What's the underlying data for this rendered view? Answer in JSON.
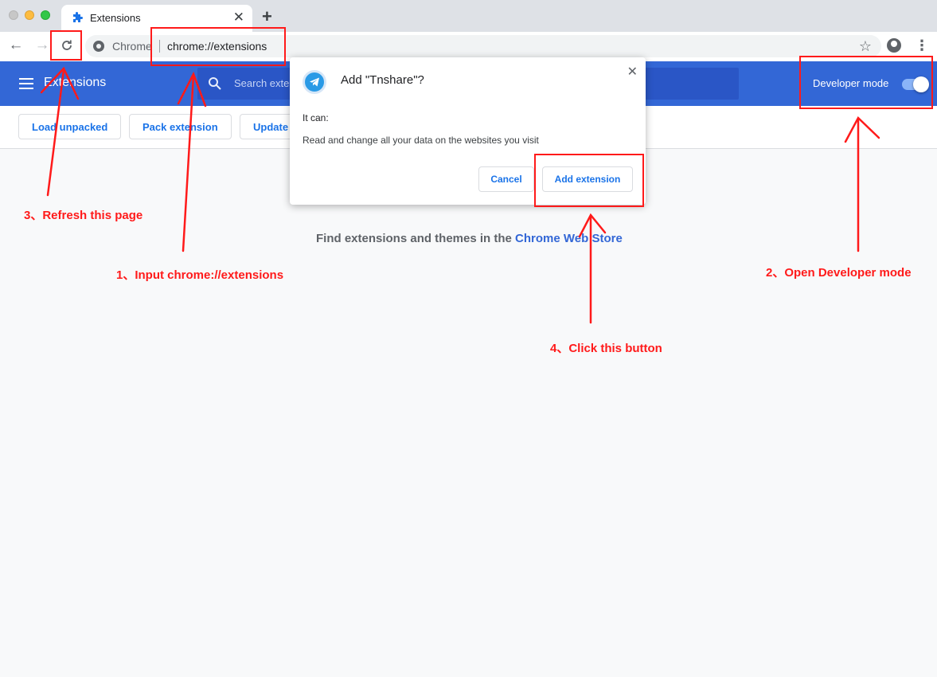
{
  "tab": {
    "title": "Extensions",
    "close": "✕"
  },
  "toolbar": {
    "site_chip": "Chrome",
    "url": "chrome://extensions"
  },
  "header": {
    "title": "Extensions",
    "search_placeholder": "Search extensions",
    "developer_mode_label": "Developer mode",
    "developer_mode_on": true
  },
  "subbar": {
    "load_unpacked": "Load unpacked",
    "pack_extension": "Pack extension",
    "update": "Update"
  },
  "main": {
    "find_text": "Find extensions and themes in the ",
    "store_link": "Chrome Web Store"
  },
  "dialog": {
    "title": "Add \"Tnshare\"?",
    "close": "✕",
    "it_can": "It can:",
    "permission": "Read and change all your data on the websites you visit",
    "cancel": "Cancel",
    "add": "Add extension"
  },
  "annotations": {
    "step1": "1、Input chrome://extensions",
    "step2": "2、Open Developer mode",
    "step3": "3、Refresh this page",
    "step4": "4、Click this button",
    "color": "#ff1a1a"
  },
  "colors": {
    "header_bg": "#3367d6",
    "accent": "#1a73e8"
  }
}
